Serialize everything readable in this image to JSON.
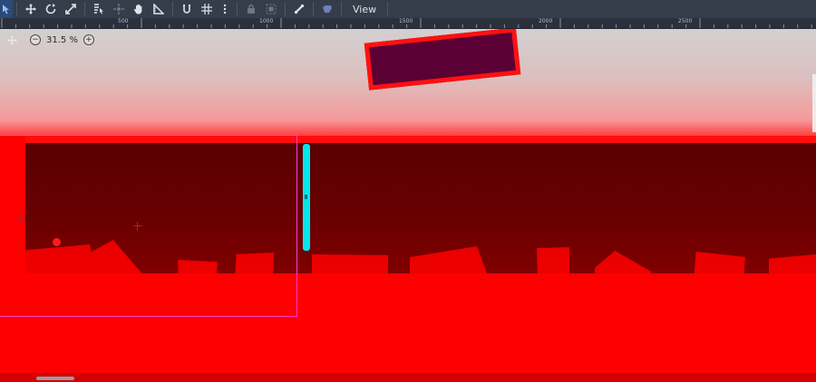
{
  "toolbar": {
    "view_label": "View",
    "tools": [
      {
        "name": "select-tool-icon",
        "active": true
      },
      {
        "name": "move-tool-icon"
      },
      {
        "name": "rotate-tool-icon"
      },
      {
        "name": "scale-tool-icon"
      },
      {
        "name": "list-select-icon"
      },
      {
        "name": "pivot-icon"
      },
      {
        "name": "pan-tool-icon"
      },
      {
        "name": "ruler-tool-icon"
      },
      {
        "name": "smart-snap-icon"
      },
      {
        "name": "grid-snap-icon"
      },
      {
        "name": "more-options-icon"
      },
      {
        "name": "lock-icon",
        "dim": true
      },
      {
        "name": "group-icon",
        "dim": true
      },
      {
        "name": "bone-icon"
      },
      {
        "name": "override-camera-icon"
      }
    ]
  },
  "ruler": {
    "labels": [
      "500",
      "1000",
      "1500",
      "2000",
      "2500"
    ]
  },
  "zoom": {
    "level": "31.5 %",
    "minus": "−",
    "plus": "+"
  },
  "colors": {
    "toolbar_bg": "#363d4a",
    "level_red": "#ff0000",
    "dark_zone": "#5f0000",
    "platform": "#5a0035",
    "selection": "#ff3ec8",
    "cyan_bar": "#00e8ec"
  }
}
